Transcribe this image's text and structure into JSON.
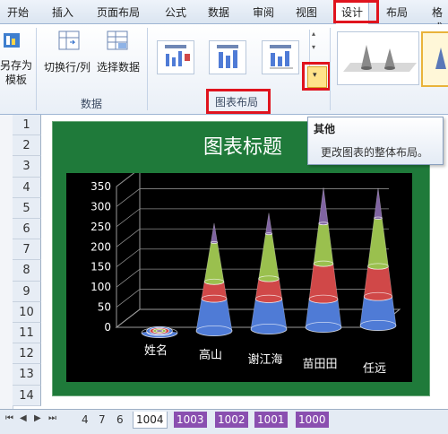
{
  "ribbon_tabs": [
    "开始",
    "插入",
    "页面布局",
    "公式",
    "数据",
    "审阅",
    "视图",
    "设计",
    "布局",
    "格式"
  ],
  "active_tab": "设计",
  "groups": {
    "type": {
      "button": "另存为\n模板"
    },
    "data": {
      "label": "数据",
      "switch_btn": "切换行/列",
      "select_btn": "选择数据"
    },
    "layouts": {
      "label": "图表布局"
    }
  },
  "tooltip": {
    "title": "其他",
    "body": "更改图表的整体布局。"
  },
  "rows": [
    "1",
    "2",
    "3",
    "4",
    "5",
    "6",
    "7",
    "8",
    "9",
    "10",
    "11",
    "12",
    "13",
    "14"
  ],
  "chart_data": {
    "type": "bar",
    "shape": "3d-cone-stacked",
    "title": "图表标题",
    "categories": [
      "姓名",
      "高山",
      "谢江海",
      "苗田田",
      "任远"
    ],
    "series": [
      {
        "color": "#4f7bd6",
        "values": [
          2,
          80,
          75,
          70,
          72
        ]
      },
      {
        "color": "#d04848",
        "values": [
          2,
          42,
          50,
          88,
          75
        ]
      },
      {
        "color": "#9ac04e",
        "values": [
          2,
          98,
          112,
          100,
          120
        ]
      },
      {
        "color": "#8064a2",
        "values": [
          1,
          48,
          52,
          90,
          75
        ]
      }
    ],
    "yticks": [
      "0",
      "50",
      "100",
      "150",
      "200",
      "250",
      "300",
      "350"
    ],
    "ylim": [
      0,
      350
    ]
  },
  "sheet_tabs": [
    "4",
    "7",
    "6",
    "1004",
    "1003",
    "1002",
    "1001",
    "1000"
  ],
  "active_sheet": "1004",
  "colors": {
    "accent_red": "#e0141e",
    "chart_bg": "#1f7a3a",
    "plot_bg": "#000000"
  }
}
